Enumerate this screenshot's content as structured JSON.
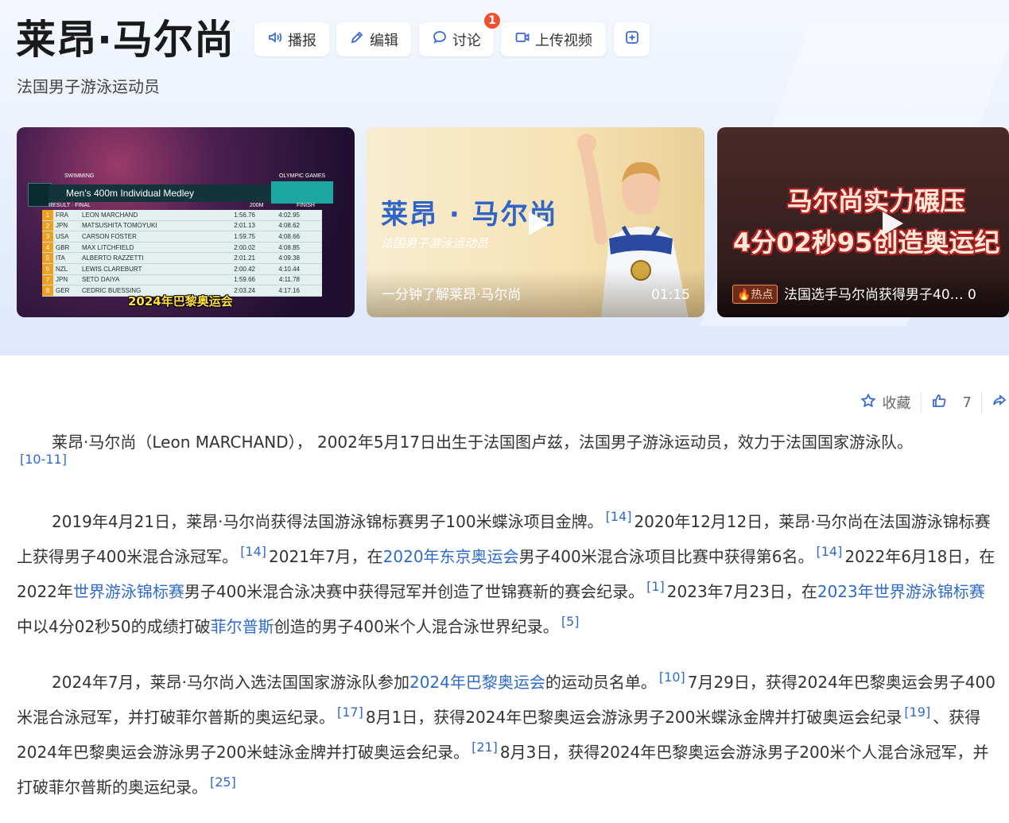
{
  "header": {
    "title": "莱昂·马尔尚",
    "subtitle": "法国男子游泳运动员"
  },
  "toolbar": {
    "broadcast_label": "播报",
    "edit_label": "编辑",
    "discuss_label": "讨论",
    "discuss_badge": "1",
    "upload_label": "上传视频"
  },
  "videos": [
    {
      "caption": "2024年巴黎奥运会",
      "board": {
        "event_tag": "SWIMMING",
        "games_tag": "OLYMPIC GAMES",
        "title": "Men's 400m Individual Medley",
        "stage": "RESULT · FINAL",
        "split_head": "200M",
        "finish_head": "FINISH",
        "rows": [
          {
            "rank": "1",
            "country": "FRA",
            "name": "LEON MARCHAND",
            "split": "1:56.76",
            "finish": "4:02.95"
          },
          {
            "rank": "2",
            "country": "JPN",
            "name": "MATSUSHITA TOMOYUKI",
            "split": "2:01.13",
            "finish": "4:08.62"
          },
          {
            "rank": "3",
            "country": "USA",
            "name": "CARSON FOSTER",
            "split": "1:59.75",
            "finish": "4:08.66"
          },
          {
            "rank": "4",
            "country": "GBR",
            "name": "MAX LITCHFIELD",
            "split": "2:00.02",
            "finish": "4:08.85"
          },
          {
            "rank": "5",
            "country": "ITA",
            "name": "ALBERTO RAZZETTI",
            "split": "2:01.21",
            "finish": "4:09.38"
          },
          {
            "rank": "6",
            "country": "NZL",
            "name": "LEWIS CLAREBURT",
            "split": "2:00.42",
            "finish": "4:10.44"
          },
          {
            "rank": "7",
            "country": "JPN",
            "name": "SETO DAIYA",
            "split": "1:59.66",
            "finish": "4:11.78"
          },
          {
            "rank": "8",
            "country": "GER",
            "name": "CEDRIC BUESSING",
            "split": "2:03.24",
            "finish": "4:17.16"
          }
        ]
      }
    },
    {
      "art_title": "莱昂 · 马尔尚",
      "art_subtitle": "法国男子游泳运动员",
      "caption": "一分钟了解莱昂·马尔尚",
      "duration": "01:15"
    },
    {
      "art_line1": "马尔尚实力碾压",
      "art_line2": "4分02秒95创造奥运纪",
      "hot_tag": "🔥热点",
      "caption": "法国选手马尔尚获得男子40… 0"
    }
  ],
  "actions": {
    "favorite_label": "收藏",
    "like_count": "7"
  },
  "content": {
    "p1": {
      "text": "莱昂·马尔尚（Leon MARCHAND）， 2002年5月17日出生于法国图卢兹，法国男子游泳运动员，效力于法国国家游泳队。",
      "ref": "[10-11]"
    },
    "p2": {
      "s1": "2019年4月21日，莱昂·马尔尚获得法国游泳锦标赛男子100米蝶泳项目金牌。",
      "r1": "[14]",
      "s2": "2020年12月12日，莱昂·马尔尚在法国游泳锦标赛上获得男子400米混合泳冠军。",
      "r2": "[14]",
      "s3a": "2021年7月，在",
      "l1": "2020年东京奥运会",
      "s3b": "男子400米混合泳项目比赛中获得第6名。",
      "r3": "[14]",
      "s4a": "2022年6月18日，在2022年",
      "l2": "世界游泳锦标赛",
      "s4b": "男子400米混合泳决赛中获得冠军并创造了世锦赛新的赛会纪录。",
      "r4": "[1]",
      "s5a": "2023年7月23日，在",
      "l3": "2023年世界游泳锦标赛",
      "s5b": "中以4分02秒50的成绩打破",
      "l4": "菲尔普斯",
      "s5c": "创造的男子400米个人混合泳世界纪录。",
      "r5": "[5]"
    },
    "p3": {
      "s1a": "2024年7月，莱昂·马尔尚入选法国国家游泳队参加",
      "l1": "2024年巴黎奥运会",
      "s1b": "的运动员名单。",
      "r1": "[10]",
      "s2": "7月29日，获得2024年巴黎奥运会男子400米混合泳冠军，并打破菲尔普斯的奥运纪录。",
      "r2": "[17]",
      "s3": "8月1日，获得2024年巴黎奥运会游泳男子200米蝶泳金牌并打破奥运会纪录",
      "r3": "[19]",
      "s4": "、获得2024年巴黎奥运会游泳男子200米蛙泳金牌并打破奥运会纪录。",
      "r4": "[21]",
      "s5": "8月3日，获得2024年巴黎奥运会游泳男子200米个人混合泳冠军，并打破菲尔普斯的奥运纪录。",
      "r5": "[25]"
    }
  }
}
